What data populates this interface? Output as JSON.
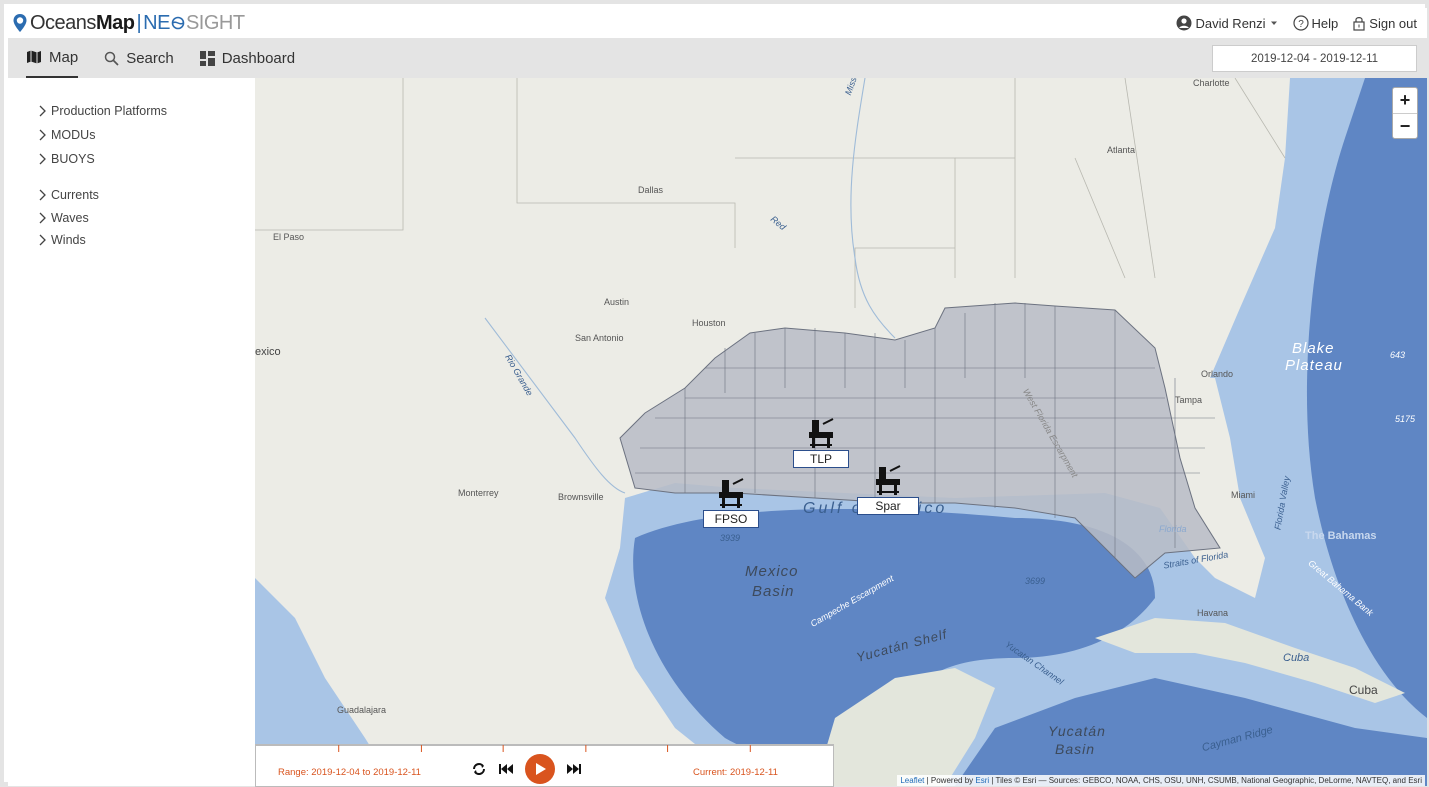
{
  "header": {
    "brand_main": "Oceans",
    "brand_bold": "Map",
    "brand_sep": "|",
    "brand_neo": "NE",
    "brand_sight": "SIGHT",
    "user_name": "David Renzi",
    "help_label": "Help",
    "signout_label": "Sign out"
  },
  "tabs": [
    {
      "label": "Map",
      "icon": "map-icon"
    },
    {
      "label": "Search",
      "icon": "search-icon"
    },
    {
      "label": "Dashboard",
      "icon": "dashboard-icon"
    }
  ],
  "date_range": "2019-12-04 - 2019-12-11",
  "sidebar": {
    "assets": [
      "Production Platforms",
      "MODUs",
      "BUOYS"
    ],
    "metocean": [
      "Currents",
      "Waves",
      "Winds"
    ]
  },
  "map": {
    "zoom_in": "+",
    "zoom_out": "−",
    "platforms": [
      "TLP",
      "Spar",
      "FPSO"
    ],
    "labels": {
      "charlotte": "Charlotte",
      "atlanta": "Atlanta",
      "dallas": "Dallas",
      "elpaso": "El Paso",
      "austin": "Austin",
      "houston": "Houston",
      "sanantonio": "San Antonio",
      "mexico": "exico",
      "monterrey": "Monterrey",
      "brownsville": "Brownsville",
      "orlando": "Orlando",
      "tampa": "Tampa",
      "miami": "Miami",
      "havana": "Havana",
      "cuba1": "Cuba",
      "cuba2": "Cuba",
      "guadalajara": "Guadalajara",
      "mississippi": "Mississippi",
      "red": "Red",
      "riogrande": "Rio Grande",
      "gulf": "Gulf of Mexico",
      "basin1": "Mexico",
      "basin2": "Basin",
      "yuc_shelf": "Yucatán Shelf",
      "yuc_basin1": "Yucatán",
      "yuc_basin2": "Basin",
      "blake1": "Blake",
      "blake2": "Plateau",
      "bahamas": "The Bahamas",
      "straits": "Straits of Florida",
      "florida": "Florida",
      "florida_valley": "Florida Valley",
      "great_bahama": "Great Bahama Bank",
      "campeche": "Campeche Escarpment",
      "yuc_channel": "Yucatan Channel",
      "cayman": "Cayman Ridge",
      "wfe": "West Florida Escarpment",
      "d3939": "3939",
      "d3699": "3699",
      "d643": "643",
      "d5175": "5175"
    }
  },
  "timeline": {
    "range": "Range: 2019-12-04 to 2019-12-11",
    "current": "Current: 2019-12-11"
  },
  "attribution": {
    "leaflet": "Leaflet",
    "powered": " | Powered by ",
    "esri": "Esri",
    "rest": " | Tiles © Esri — Sources: GEBCO, NOAA, CHS, OSU, UNH, CSUMB, National Geographic, DeLorme, NAVTEQ, and Esri"
  },
  "colors": {
    "accent": "#d9541e",
    "brand_blue": "#2b6cb0",
    "ocean": "#a9c5e6",
    "deep_ocean": "#5f86c4",
    "land": "#ecece6",
    "lease_area": "#b8bcc6"
  }
}
